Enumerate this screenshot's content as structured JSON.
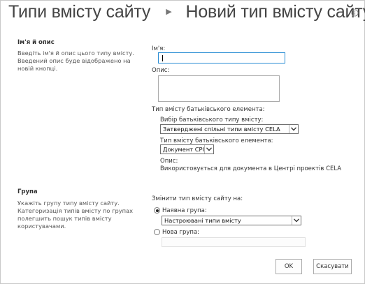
{
  "header": {
    "breadcrumb_parent": "Типи вмісту сайту",
    "breadcrumb_current": "Новий тип вмісту сайту",
    "separator_icon": "triangle-right-icon",
    "info_icon": "info-icon"
  },
  "name_section": {
    "title": "Ім'я й опис",
    "description": "Введіть ім'я й опис цього типу вмісту. Введений опис буде відображено на новій кнопці.",
    "name_label": "Ім'я:",
    "name_value": "",
    "description_label": "Опис:",
    "description_value": "",
    "parent_heading": "Тип вмісту батьківського елемента:",
    "parent_group_label": "Вибір батьківського типу вмісту:",
    "parent_group_selected": "Затверджені спільні типи вмісту CELA",
    "parent_type_label": "Тип вмісту батьківського елемента:",
    "parent_type_selected": "Документ CPC",
    "parent_desc_label": "Опис:",
    "parent_desc_text": "Використовується для документа в Центрі проектів CELA"
  },
  "group_section": {
    "title": "Група",
    "description": "Укажіть групу типу вмісту сайту. Категоризація типів вмісту по групах полегшить пошук типів вмісту користувачами.",
    "change_label": "Змінити тип вмісту сайту на:",
    "existing_label": "Наявна група:",
    "existing_selected": "Настроювані типи вмісту",
    "existing_checked": true,
    "new_label": "Нова група:",
    "new_value": "",
    "new_checked": false
  },
  "buttons": {
    "ok": "OK",
    "cancel": "Скасувати"
  },
  "colors": {
    "text": "#444444",
    "focus_border": "#2a8dd4",
    "border": "#ababab"
  }
}
